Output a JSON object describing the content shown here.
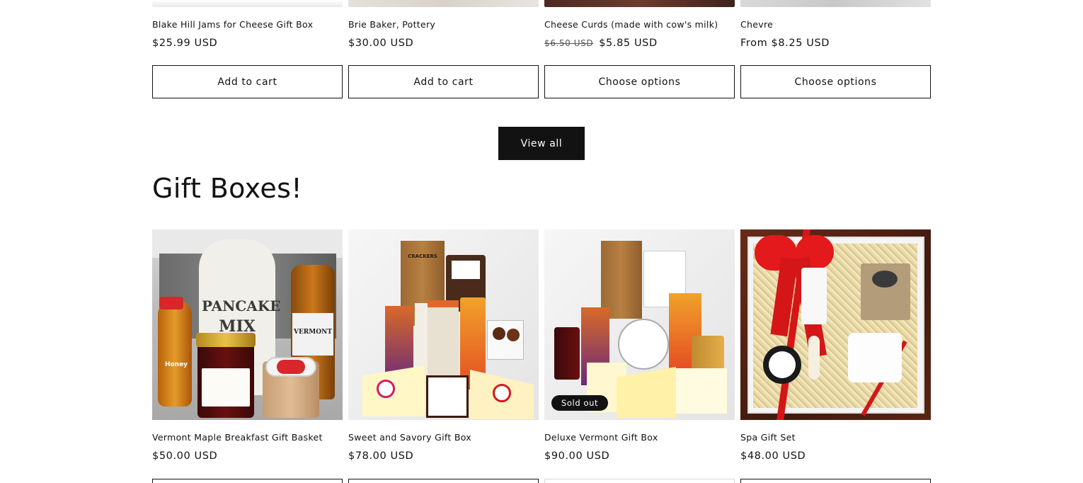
{
  "top_products": [
    {
      "title": "Blake Hill Jams for Cheese Gift Box",
      "price": "$25.99 USD",
      "old_price": "",
      "button": "Add to cart"
    },
    {
      "title": "Brie Baker, Pottery",
      "price": "$30.00 USD",
      "old_price": "",
      "button": "Add to cart"
    },
    {
      "title": "Cheese Curds (made with cow's milk)",
      "price": "$5.85 USD",
      "old_price": "$6.50 USD",
      "button": "Choose options"
    },
    {
      "title": "Chevre",
      "price": "From $8.25 USD",
      "old_price": "",
      "button": "Choose options"
    }
  ],
  "view_all_label": "View all",
  "section_title": "Gift Boxes!",
  "gift_products": [
    {
      "title": "Vermont Maple Breakfast Gift Basket",
      "price": "$50.00 USD",
      "badge": ""
    },
    {
      "title": "Sweet and Savory Gift Box",
      "price": "$78.00 USD",
      "badge": ""
    },
    {
      "title": "Deluxe Vermont Gift Box",
      "price": "$90.00 USD",
      "badge": "Sold out"
    },
    {
      "title": "Spa Gift Set",
      "price": "$48.00 USD",
      "badge": ""
    }
  ],
  "image_text": {
    "pancake_bag_line1": "PANCAKE",
    "pancake_bag_line2": "MIX",
    "honey": "Honey",
    "vermont": "VERMONT",
    "crackers": "CRACKERS"
  },
  "colors": {
    "text": "#121212",
    "button_dark": "#121212",
    "ribbon": "#e3191b"
  }
}
